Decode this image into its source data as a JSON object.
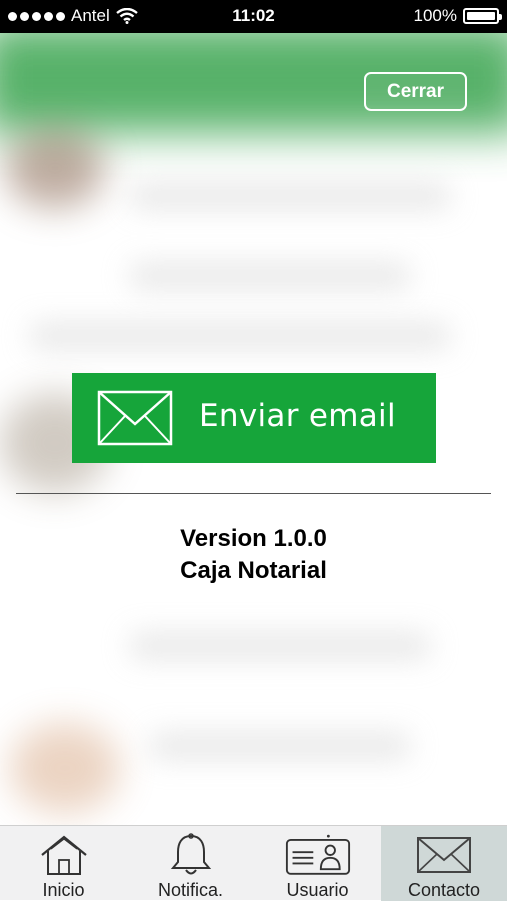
{
  "status_bar": {
    "carrier": "Antel",
    "time": "11:02",
    "battery": "100%"
  },
  "header": {
    "close_label": "Cerrar"
  },
  "contact": {
    "email_button_label": "Enviar email",
    "version_line": "Version 1.0.0",
    "company_line": "Caja Notarial"
  },
  "tabs": [
    {
      "label": "Inicio",
      "icon": "home-icon"
    },
    {
      "label": "Notifica.",
      "icon": "bell-icon"
    },
    {
      "label": "Usuario",
      "icon": "user-card-icon"
    },
    {
      "label": "Contacto",
      "icon": "envelope-icon",
      "active": true
    }
  ],
  "colors": {
    "email_button": "#16a53a",
    "active_tab": "#cfd8d7"
  }
}
